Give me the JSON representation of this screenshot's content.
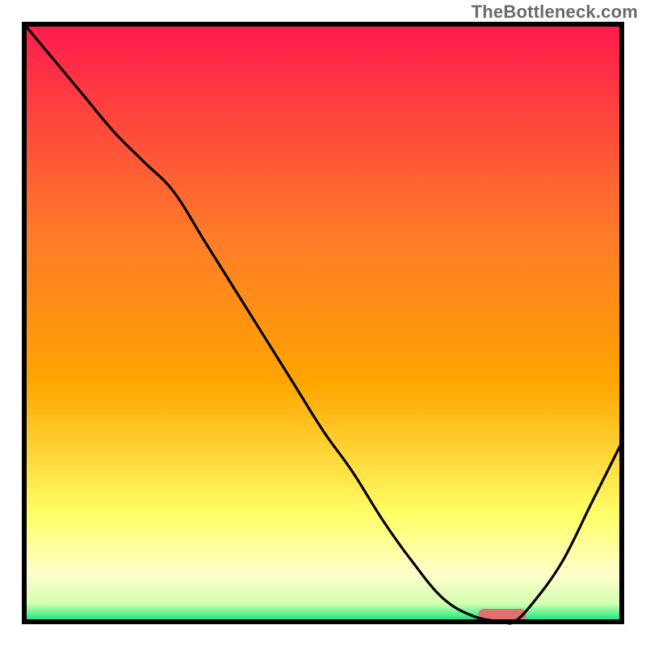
{
  "watermark": "TheBottleneck.com",
  "chart_data": {
    "type": "line",
    "title": "",
    "xlabel": "",
    "ylabel": "",
    "xlim": [
      0,
      100
    ],
    "ylim": [
      0,
      100
    ],
    "x": [
      0,
      5,
      10,
      15,
      20,
      25,
      30,
      35,
      40,
      45,
      50,
      55,
      60,
      65,
      70,
      75,
      80,
      82,
      85,
      90,
      95,
      100
    ],
    "values": [
      100,
      94,
      88,
      82,
      77,
      72,
      64,
      56,
      48,
      40,
      32,
      25,
      17,
      10,
      4,
      1,
      0,
      0,
      3,
      10,
      20,
      30
    ],
    "highlight_range_x": [
      76,
      84
    ],
    "colors": {
      "gradient_top": "#ff1a4d",
      "gradient_mid": "#ffa500",
      "gradient_low": "#ffff66",
      "gradient_pale": "#ffffcc",
      "gradient_bottom": "#00e67a",
      "line": "#000000",
      "border": "#000000",
      "highlight": "#e07070"
    }
  }
}
